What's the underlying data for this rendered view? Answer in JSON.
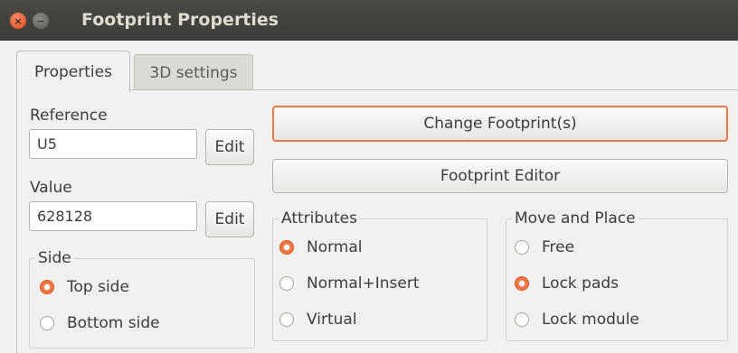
{
  "window": {
    "title": "Footprint Properties",
    "close_glyph": "×",
    "minimize_glyph": "−"
  },
  "tabs": [
    {
      "label": "Properties",
      "active": true
    },
    {
      "label": "3D settings",
      "active": false
    }
  ],
  "reference": {
    "label": "Reference",
    "value": "U5",
    "edit_label": "Edit"
  },
  "value_field": {
    "label": "Value",
    "value": "628128",
    "edit_label": "Edit"
  },
  "side": {
    "legend": "Side",
    "options": [
      {
        "label": "Top side",
        "selected": true
      },
      {
        "label": "Bottom side",
        "selected": false
      }
    ]
  },
  "buttons": {
    "change_footprint": "Change Footprint(s)",
    "footprint_editor": "Footprint Editor"
  },
  "attributes": {
    "legend": "Attributes",
    "options": [
      {
        "label": "Normal",
        "selected": true
      },
      {
        "label": "Normal+Insert",
        "selected": false
      },
      {
        "label": "Virtual",
        "selected": false
      }
    ]
  },
  "move_place": {
    "legend": "Move and Place",
    "options": [
      {
        "label": "Free",
        "selected": false
      },
      {
        "label": "Lock pads",
        "selected": true
      },
      {
        "label": "Lock module",
        "selected": false
      }
    ]
  },
  "colors": {
    "accent": "#f07746",
    "titlebar": "#3c3b37",
    "background": "#f2f1f0"
  }
}
